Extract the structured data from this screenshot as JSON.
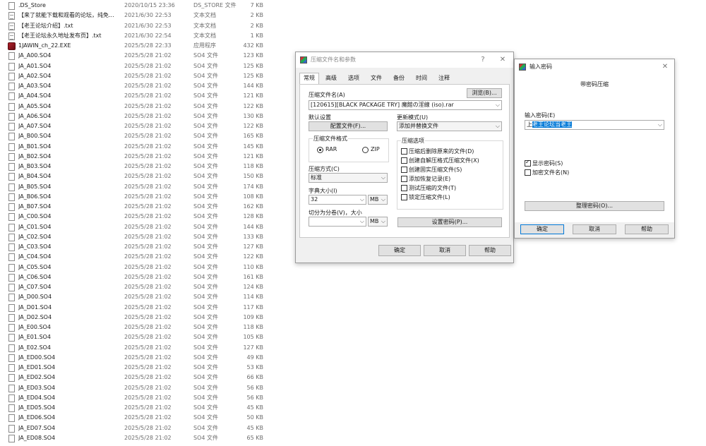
{
  "files": [
    {
      "icon": "doc",
      "name": ".DS_Store",
      "date": "2020/10/15 23:36",
      "type": "DS_STORE 文件",
      "size": "7 KB"
    },
    {
      "icon": "txt",
      "name": "【来了就能下载和观看的论坛，纯免...",
      "date": "2021/6/30 22:53",
      "type": "文本文档",
      "size": "2 KB"
    },
    {
      "icon": "txt",
      "name": "【老王论坛介绍】.txt",
      "date": "2021/6/30 22:53",
      "type": "文本文档",
      "size": "2 KB"
    },
    {
      "icon": "txt",
      "name": "【老王论坛永久地址发布页】.txt",
      "date": "2021/6/30 22:54",
      "type": "文本文档",
      "size": "1 KB"
    },
    {
      "icon": "exe",
      "name": "1JAWIN_ch_22.EXE",
      "date": "2025/5/28 22:33",
      "type": "应用程序",
      "size": "432 KB"
    },
    {
      "icon": "doc",
      "name": "JA_A00.SO4",
      "date": "2025/5/28 21:02",
      "type": "SO4 文件",
      "size": "123 KB"
    },
    {
      "icon": "doc",
      "name": "JA_A01.SO4",
      "date": "2025/5/28 21:02",
      "type": "SO4 文件",
      "size": "125 KB"
    },
    {
      "icon": "doc",
      "name": "JA_A02.SO4",
      "date": "2025/5/28 21:02",
      "type": "SO4 文件",
      "size": "125 KB"
    },
    {
      "icon": "doc",
      "name": "JA_A03.SO4",
      "date": "2025/5/28 21:02",
      "type": "SO4 文件",
      "size": "144 KB"
    },
    {
      "icon": "doc",
      "name": "JA_A04.SO4",
      "date": "2025/5/28 21:02",
      "type": "SO4 文件",
      "size": "121 KB"
    },
    {
      "icon": "doc",
      "name": "JA_A05.SO4",
      "date": "2025/5/28 21:02",
      "type": "SO4 文件",
      "size": "122 KB"
    },
    {
      "icon": "doc",
      "name": "JA_A06.SO4",
      "date": "2025/5/28 21:02",
      "type": "SO4 文件",
      "size": "130 KB"
    },
    {
      "icon": "doc",
      "name": "JA_A07.SO4",
      "date": "2025/5/28 21:02",
      "type": "SO4 文件",
      "size": "122 KB"
    },
    {
      "icon": "doc",
      "name": "JA_B00.SO4",
      "date": "2025/5/28 21:02",
      "type": "SO4 文件",
      "size": "165 KB"
    },
    {
      "icon": "doc",
      "name": "JA_B01.SO4",
      "date": "2025/5/28 21:02",
      "type": "SO4 文件",
      "size": "145 KB"
    },
    {
      "icon": "doc",
      "name": "JA_B02.SO4",
      "date": "2025/5/28 21:02",
      "type": "SO4 文件",
      "size": "121 KB"
    },
    {
      "icon": "doc",
      "name": "JA_B03.SO4",
      "date": "2025/5/28 21:02",
      "type": "SO4 文件",
      "size": "118 KB"
    },
    {
      "icon": "doc",
      "name": "JA_B04.SO4",
      "date": "2025/5/28 21:02",
      "type": "SO4 文件",
      "size": "150 KB"
    },
    {
      "icon": "doc",
      "name": "JA_B05.SO4",
      "date": "2025/5/28 21:02",
      "type": "SO4 文件",
      "size": "174 KB"
    },
    {
      "icon": "doc",
      "name": "JA_B06.SO4",
      "date": "2025/5/28 21:02",
      "type": "SO4 文件",
      "size": "108 KB"
    },
    {
      "icon": "doc",
      "name": "JA_B07.SO4",
      "date": "2025/5/28 21:02",
      "type": "SO4 文件",
      "size": "162 KB"
    },
    {
      "icon": "doc",
      "name": "JA_C00.SO4",
      "date": "2025/5/28 21:02",
      "type": "SO4 文件",
      "size": "128 KB"
    },
    {
      "icon": "doc",
      "name": "JA_C01.SO4",
      "date": "2025/5/28 21:02",
      "type": "SO4 文件",
      "size": "144 KB"
    },
    {
      "icon": "doc",
      "name": "JA_C02.SO4",
      "date": "2025/5/28 21:02",
      "type": "SO4 文件",
      "size": "133 KB"
    },
    {
      "icon": "doc",
      "name": "JA_C03.SO4",
      "date": "2025/5/28 21:02",
      "type": "SO4 文件",
      "size": "127 KB"
    },
    {
      "icon": "doc",
      "name": "JA_C04.SO4",
      "date": "2025/5/28 21:02",
      "type": "SO4 文件",
      "size": "122 KB"
    },
    {
      "icon": "doc",
      "name": "JA_C05.SO4",
      "date": "2025/5/28 21:02",
      "type": "SO4 文件",
      "size": "110 KB"
    },
    {
      "icon": "doc",
      "name": "JA_C06.SO4",
      "date": "2025/5/28 21:02",
      "type": "SO4 文件",
      "size": "161 KB"
    },
    {
      "icon": "doc",
      "name": "JA_C07.SO4",
      "date": "2025/5/28 21:02",
      "type": "SO4 文件",
      "size": "124 KB"
    },
    {
      "icon": "doc",
      "name": "JA_D00.SO4",
      "date": "2025/5/28 21:02",
      "type": "SO4 文件",
      "size": "114 KB"
    },
    {
      "icon": "doc",
      "name": "JA_D01.SO4",
      "date": "2025/5/28 21:02",
      "type": "SO4 文件",
      "size": "117 KB"
    },
    {
      "icon": "doc",
      "name": "JA_D02.SO4",
      "date": "2025/5/28 21:02",
      "type": "SO4 文件",
      "size": "109 KB"
    },
    {
      "icon": "doc",
      "name": "JA_E00.SO4",
      "date": "2025/5/28 21:02",
      "type": "SO4 文件",
      "size": "118 KB"
    },
    {
      "icon": "doc",
      "name": "JA_E01.SO4",
      "date": "2025/5/28 21:02",
      "type": "SO4 文件",
      "size": "105 KB"
    },
    {
      "icon": "doc",
      "name": "JA_E02.SO4",
      "date": "2025/5/28 21:02",
      "type": "SO4 文件",
      "size": "127 KB"
    },
    {
      "icon": "doc",
      "name": "JA_ED00.SO4",
      "date": "2025/5/28 21:02",
      "type": "SO4 文件",
      "size": "49 KB"
    },
    {
      "icon": "doc",
      "name": "JA_ED01.SO4",
      "date": "2025/5/28 21:02",
      "type": "SO4 文件",
      "size": "53 KB"
    },
    {
      "icon": "doc",
      "name": "JA_ED02.SO4",
      "date": "2025/5/28 21:02",
      "type": "SO4 文件",
      "size": "66 KB"
    },
    {
      "icon": "doc",
      "name": "JA_ED03.SO4",
      "date": "2025/5/28 21:02",
      "type": "SO4 文件",
      "size": "56 KB"
    },
    {
      "icon": "doc",
      "name": "JA_ED04.SO4",
      "date": "2025/5/28 21:02",
      "type": "SO4 文件",
      "size": "56 KB"
    },
    {
      "icon": "doc",
      "name": "JA_ED05.SO4",
      "date": "2025/5/28 21:02",
      "type": "SO4 文件",
      "size": "45 KB"
    },
    {
      "icon": "doc",
      "name": "JA_ED06.SO4",
      "date": "2025/5/28 21:02",
      "type": "SO4 文件",
      "size": "50 KB"
    },
    {
      "icon": "doc",
      "name": "JA_ED07.SO4",
      "date": "2025/5/28 21:02",
      "type": "SO4 文件",
      "size": "45 KB"
    },
    {
      "icon": "doc",
      "name": "JA_ED08.SO4",
      "date": "2025/5/28 21:02",
      "type": "SO4 文件",
      "size": "65 KB"
    }
  ],
  "archive_dialog": {
    "title": "压缩文件名和参数",
    "help_btn": "?",
    "close_btn": "✕",
    "tabs": [
      "常规",
      "高级",
      "选项",
      "文件",
      "备份",
      "时间",
      "注释"
    ],
    "archive_name_label": "压缩文件名(A)",
    "browse_btn": "浏览(B)...",
    "archive_name_value": "[120615][BLACK PACKAGE TRY] 魔館の淫線 (iso).rar",
    "default_settings_label": "默认设置",
    "profiles_btn": "配置文件(F)...",
    "update_mode_label": "更新模式(U)",
    "update_mode_value": "添加并替换文件",
    "format_label": "压缩文件格式",
    "format_rar": "RAR",
    "format_zip": "ZIP",
    "method_label": "压缩方式(C)",
    "method_value": "标准",
    "dict_label": "字典大小(I)",
    "dict_value": "32",
    "dict_unit": "MB",
    "split_label": "切分为分卷(V)，大小",
    "split_value": "",
    "split_unit": "MB",
    "options_label": "压缩选项",
    "options": [
      {
        "label": "压缩后删除原来的文件(D)",
        "checked": false
      },
      {
        "label": "创建自解压格式压缩文件(X)",
        "checked": false
      },
      {
        "label": "创建固实压缩文件(S)",
        "checked": false
      },
      {
        "label": "添加恢复记录(E)",
        "checked": false
      },
      {
        "label": "测试压缩的文件(T)",
        "checked": false
      },
      {
        "label": "锁定压缩文件(L)",
        "checked": false
      }
    ],
    "set_password_btn": "设置密码(P)...",
    "ok_btn": "确定",
    "cancel_btn": "取消",
    "help_footer_btn": "帮助"
  },
  "password_dialog": {
    "title": "输入密码",
    "close_btn": "✕",
    "subtitle": "带密码压缩",
    "enter_label": "输入密码(E)",
    "password_prefix": "上",
    "password_selected": "老王论坛当老王",
    "show_password": "显示密码(S)",
    "show_password_checked": true,
    "encrypt_names": "加密文件名(N)",
    "encrypt_names_checked": false,
    "organize_btn": "整理密码(O)...",
    "ok_btn": "确定",
    "cancel_btn": "取消",
    "help_btn": "帮助"
  }
}
